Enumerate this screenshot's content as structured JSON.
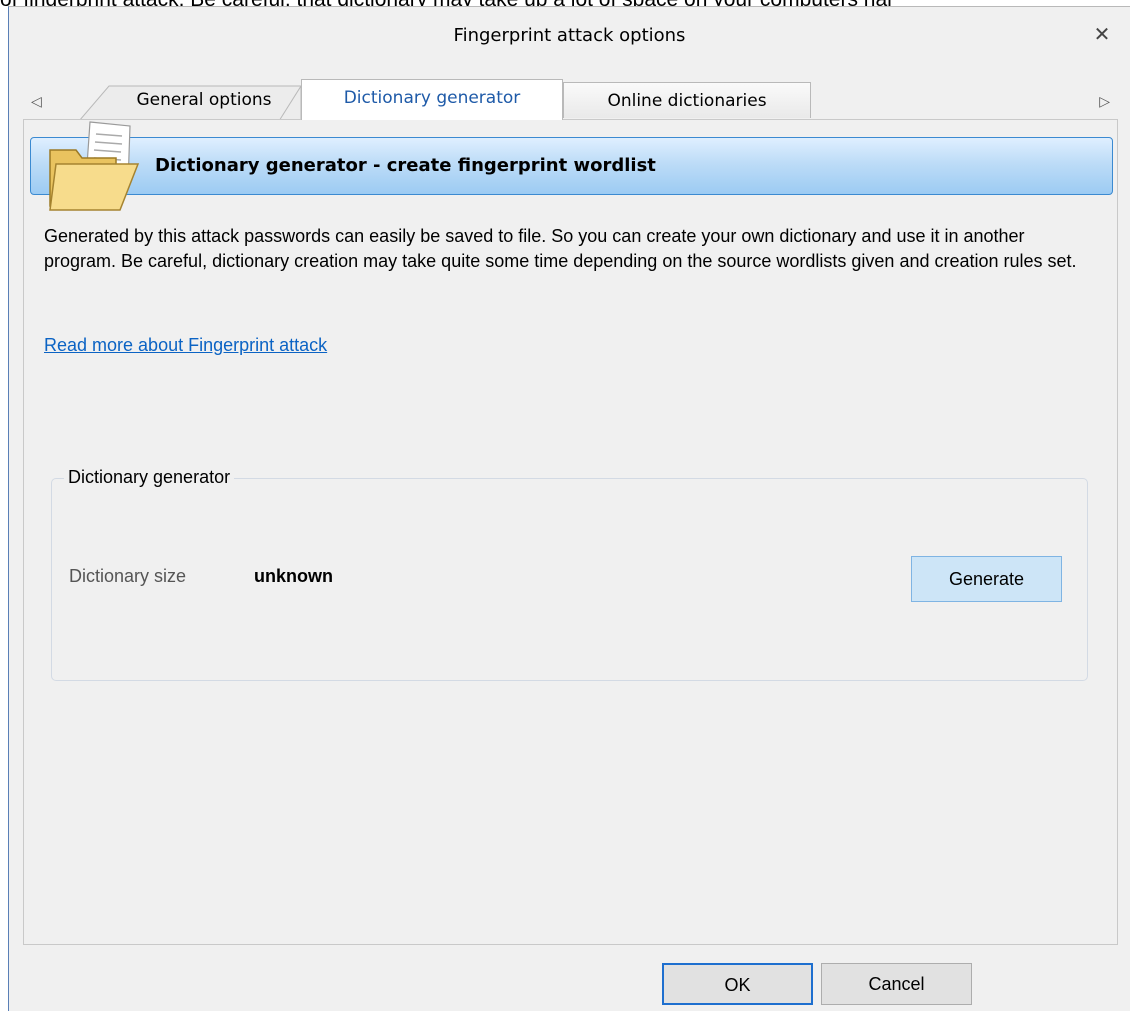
{
  "background_text": "of fingerprint attack. Be careful, that dictionary may take up a lot of space on your computers har",
  "window": {
    "title": "Fingerprint attack options",
    "close_glyph": "✕"
  },
  "tabs": [
    {
      "label": "General options"
    },
    {
      "label": "Dictionary generator",
      "active": true
    },
    {
      "label": "Online dictionaries"
    }
  ],
  "tab_scroll": {
    "left": "◁",
    "right": "▷"
  },
  "panel": {
    "header_title": "Dictionary generator - create fingerprint wordlist",
    "description": "Generated by this attack passwords can easily be saved to file. So you can create your own dictionary and use it in another program. Be careful, dictionary creation may take quite some time depending on the source wordlists given and creation rules set.",
    "read_more": "Read more about Fingerprint attack",
    "group": {
      "legend": "Dictionary generator",
      "size_label": "Dictionary size",
      "size_value": "unknown",
      "generate_label": "Generate"
    }
  },
  "footer": {
    "ok_label": "OK",
    "cancel_label": "Cancel"
  },
  "colors": {
    "header_border": "#3b8ad1",
    "link": "#0b63c4",
    "active_tab_text": "#1e5aa8"
  }
}
